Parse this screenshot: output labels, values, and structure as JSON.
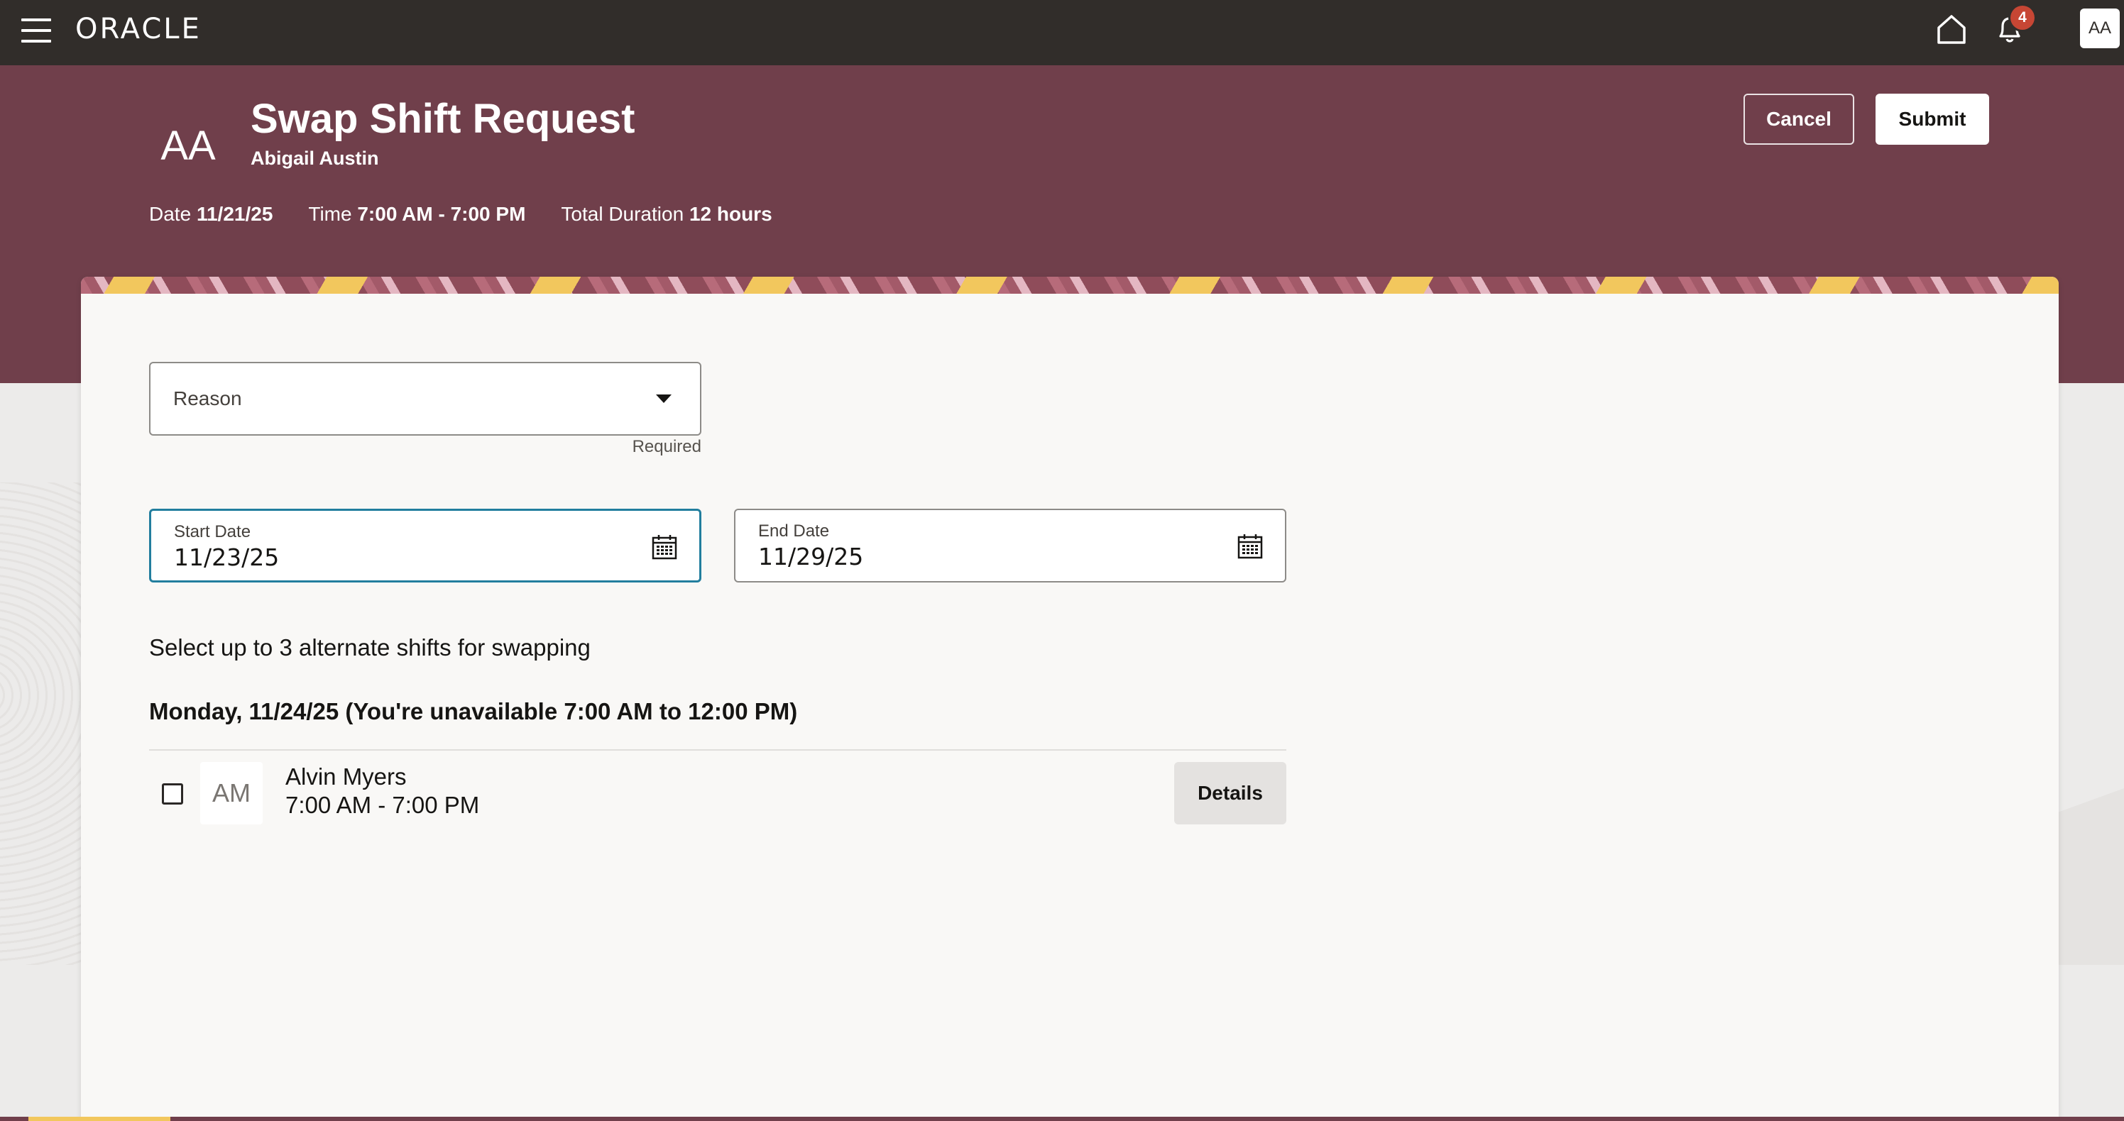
{
  "topbar": {
    "logo_text": "ORACLE",
    "notification_count": "4",
    "user_initials": "AA",
    "icons": [
      "menu-icon",
      "home-icon",
      "bell-icon"
    ]
  },
  "header": {
    "avatar_initials": "AA",
    "title": "Swap Shift Request",
    "subtitle": "Abigail Austin",
    "date_label": "Date",
    "date_value": "11/21/25",
    "time_label": "Time",
    "time_value": "7:00 AM - 7:00 PM",
    "duration_label": "Total Duration",
    "duration_value": "12 hours",
    "cancel_label": "Cancel",
    "submit_label": "Submit"
  },
  "form": {
    "reason_placeholder": "Reason",
    "reason_helper": "Required",
    "start_date_label": "Start Date",
    "start_date_value": "11/23/25",
    "end_date_label": "End Date",
    "end_date_value": "11/29/25",
    "instruction": "Select up to 3 alternate shifts for swapping"
  },
  "shifts": {
    "day_heading": "Monday, 11/24/25 (You're unavailable 7:00 AM to 12:00 PM)",
    "rows": [
      {
        "initials": "AM",
        "name": "Alvin Myers",
        "time": "7:00 AM - 7:00 PM",
        "details_label": "Details",
        "checked": false
      }
    ]
  },
  "colors": {
    "topbar_bg": "#312d2a",
    "header_bg": "#703f4b",
    "badge": "#c74634",
    "focus_border": "#227e9e"
  }
}
